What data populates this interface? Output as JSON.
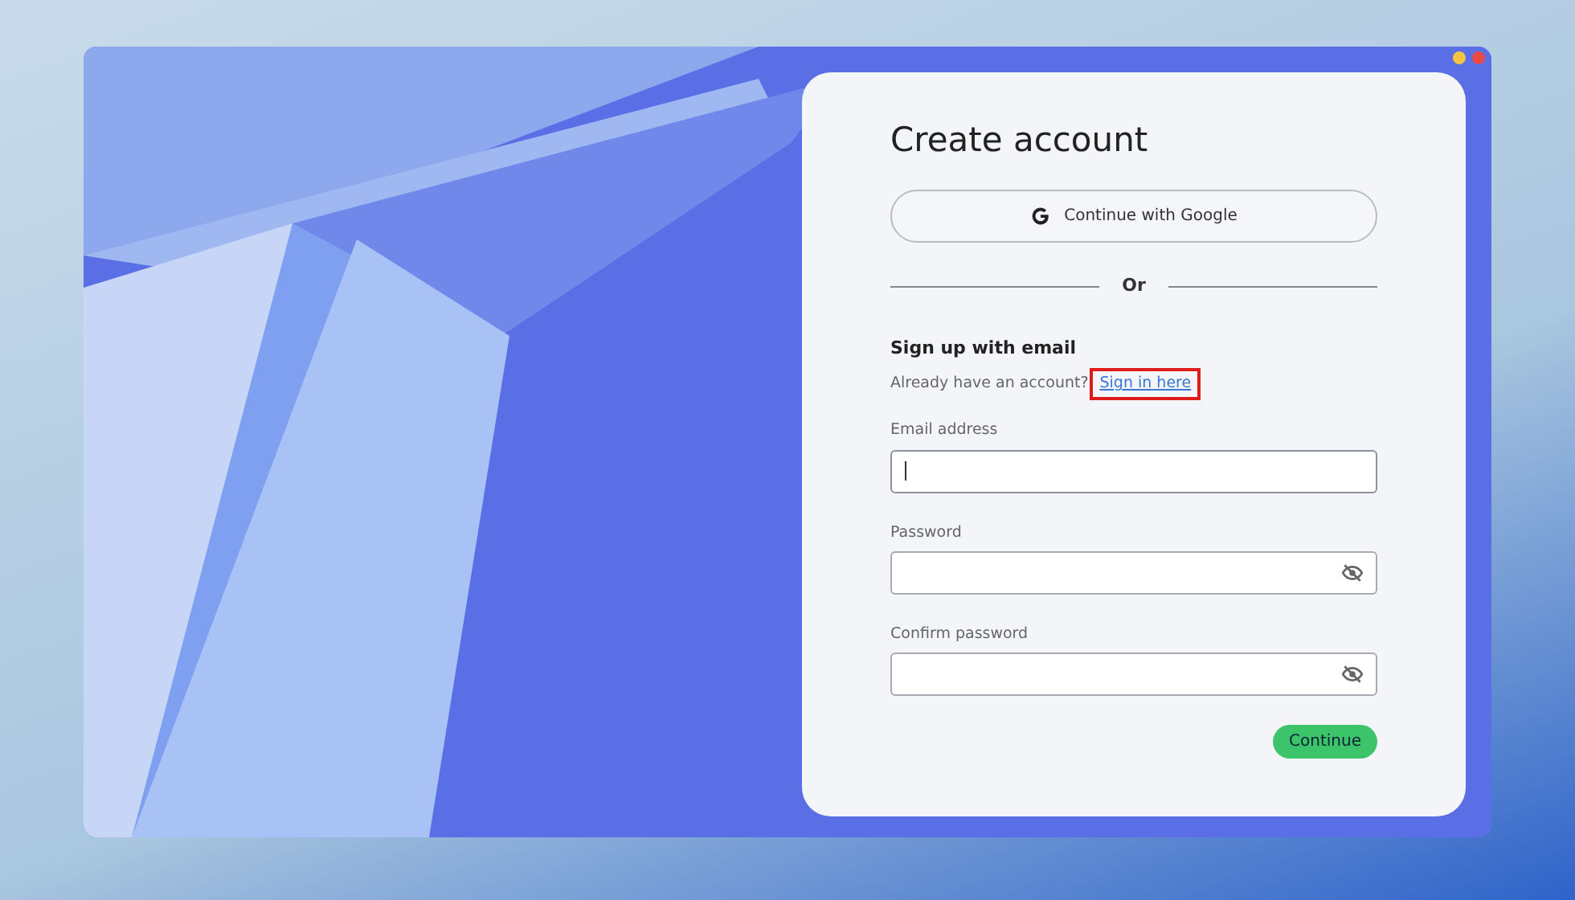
{
  "window": {
    "controls": [
      {
        "color": "#f5c542"
      },
      {
        "color": "#ec4b43"
      }
    ]
  },
  "form": {
    "title": "Create account",
    "google_button": "Continue with Google",
    "divider": "Or",
    "section_title": "Sign up with email",
    "prompt": "Already have an account?",
    "link": {
      "label": "Sign in here",
      "highlighted": true
    },
    "fields": [
      {
        "label": "Email address",
        "kind": "text",
        "focused": true
      },
      {
        "label": "Password",
        "kind": "password",
        "focused": false
      },
      {
        "label": "Confirm password",
        "kind": "password",
        "focused": false
      }
    ],
    "submit": "Continue"
  }
}
